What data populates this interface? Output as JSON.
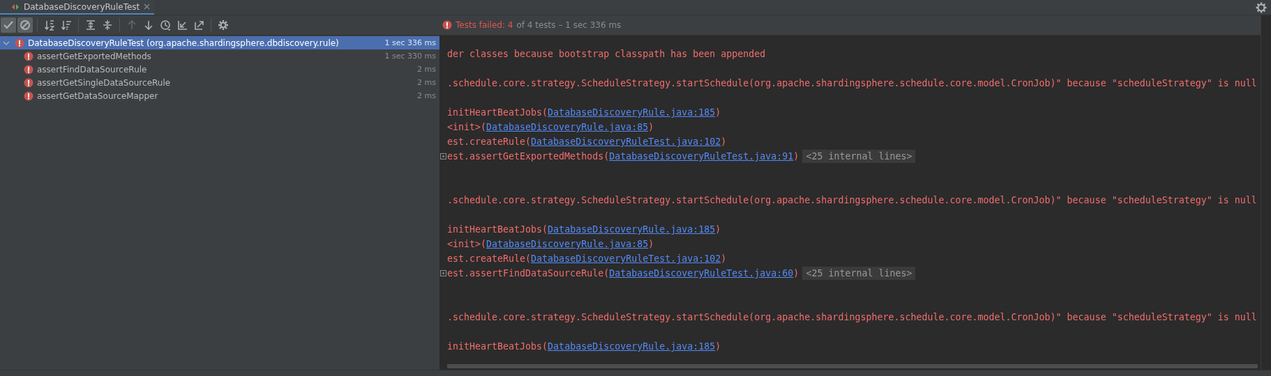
{
  "tab": {
    "title": "DatabaseDiscoveryRuleTest",
    "selected": true
  },
  "toolbar": {
    "groups": [
      [
        {
          "selected": true,
          "disabled": false
        },
        {
          "selected": true,
          "disabled": false
        }
      ],
      [
        {
          "selected": false,
          "disabled": false
        },
        {
          "selected": false,
          "disabled": false
        }
      ],
      [
        {
          "selected": false,
          "disabled": false
        },
        {
          "selected": false,
          "disabled": false
        }
      ],
      [
        {
          "selected": false,
          "disabled": true
        },
        {
          "selected": false,
          "disabled": false
        },
        {
          "selected": false,
          "disabled": false
        },
        {
          "selected": false,
          "disabled": false
        },
        {
          "selected": false,
          "disabled": false
        }
      ],
      [
        {
          "selected": false,
          "disabled": false
        }
      ]
    ]
  },
  "status": {
    "failed_label": "Tests failed: 4",
    "summary": "of 4 tests – 1 sec 336 ms"
  },
  "tree": [
    {
      "label": "DatabaseDiscoveryRuleTest (org.apache.shardingsphere.dbdiscovery.rule)",
      "time": "1 sec 336 ms",
      "kind": "failed",
      "selected": true,
      "expanded": true,
      "children": [
        {
          "label": "assertGetExportedMethods",
          "time": "1 sec 330 ms",
          "kind": "failed",
          "selected": false
        },
        {
          "label": "assertFindDataSourceRule",
          "time": "2 ms",
          "kind": "failed",
          "selected": false
        },
        {
          "label": "assertGetSingleDataSourceRule",
          "time": "2 ms",
          "kind": "failed",
          "selected": false
        },
        {
          "label": "assertGetDataSourceMapper",
          "time": "2 ms",
          "kind": "failed",
          "selected": false
        }
      ]
    }
  ],
  "console": [
    {
      "kind": "message",
      "text": "der classes because bootstrap classpath has been appended"
    },
    {
      "kind": "blank"
    },
    {
      "kind": "message",
      "text": ".schedule.core.strategy.ScheduleStrategy.startSchedule(org.apache.shardingsphere.schedule.core.model.CronJob)\" because \"scheduleStrategy\" is null"
    },
    {
      "kind": "blank"
    },
    {
      "kind": "frame",
      "prefix": "initHeartBeatJobs(",
      "link": "DatabaseDiscoveryRule.java:185",
      "suffix": ")",
      "foldable": false
    },
    {
      "kind": "frame",
      "prefix": "<init>(",
      "link": "DatabaseDiscoveryRule.java:85",
      "suffix": ")",
      "foldable": false
    },
    {
      "kind": "frame",
      "prefix": "est.createRule(",
      "link": "DatabaseDiscoveryRuleTest.java:102",
      "suffix": ")",
      "foldable": false
    },
    {
      "kind": "frame",
      "prefix": "est.assertGetExportedMethods(",
      "link": "DatabaseDiscoveryRuleTest.java:91",
      "suffix": ")",
      "foldable": true,
      "internal": "<25 internal lines>"
    },
    {
      "kind": "blank"
    },
    {
      "kind": "blank"
    },
    {
      "kind": "message",
      "text": ".schedule.core.strategy.ScheduleStrategy.startSchedule(org.apache.shardingsphere.schedule.core.model.CronJob)\" because \"scheduleStrategy\" is null"
    },
    {
      "kind": "blank"
    },
    {
      "kind": "frame",
      "prefix": "initHeartBeatJobs(",
      "link": "DatabaseDiscoveryRule.java:185",
      "suffix": ")",
      "foldable": false
    },
    {
      "kind": "frame",
      "prefix": "<init>(",
      "link": "DatabaseDiscoveryRule.java:85",
      "suffix": ")",
      "foldable": false
    },
    {
      "kind": "frame",
      "prefix": "est.createRule(",
      "link": "DatabaseDiscoveryRuleTest.java:102",
      "suffix": ")",
      "foldable": false
    },
    {
      "kind": "frame",
      "prefix": "est.assertFindDataSourceRule(",
      "link": "DatabaseDiscoveryRuleTest.java:60",
      "suffix": ")",
      "foldable": true,
      "internal": "<25 internal lines>"
    },
    {
      "kind": "blank"
    },
    {
      "kind": "blank"
    },
    {
      "kind": "message",
      "text": ".schedule.core.strategy.ScheduleStrategy.startSchedule(org.apache.shardingsphere.schedule.core.model.CronJob)\" because \"scheduleStrategy\" is null"
    },
    {
      "kind": "blank"
    },
    {
      "kind": "frame",
      "prefix": "initHeartBeatJobs(",
      "link": "DatabaseDiscoveryRule.java:185",
      "suffix": ")",
      "foldable": false
    }
  ]
}
